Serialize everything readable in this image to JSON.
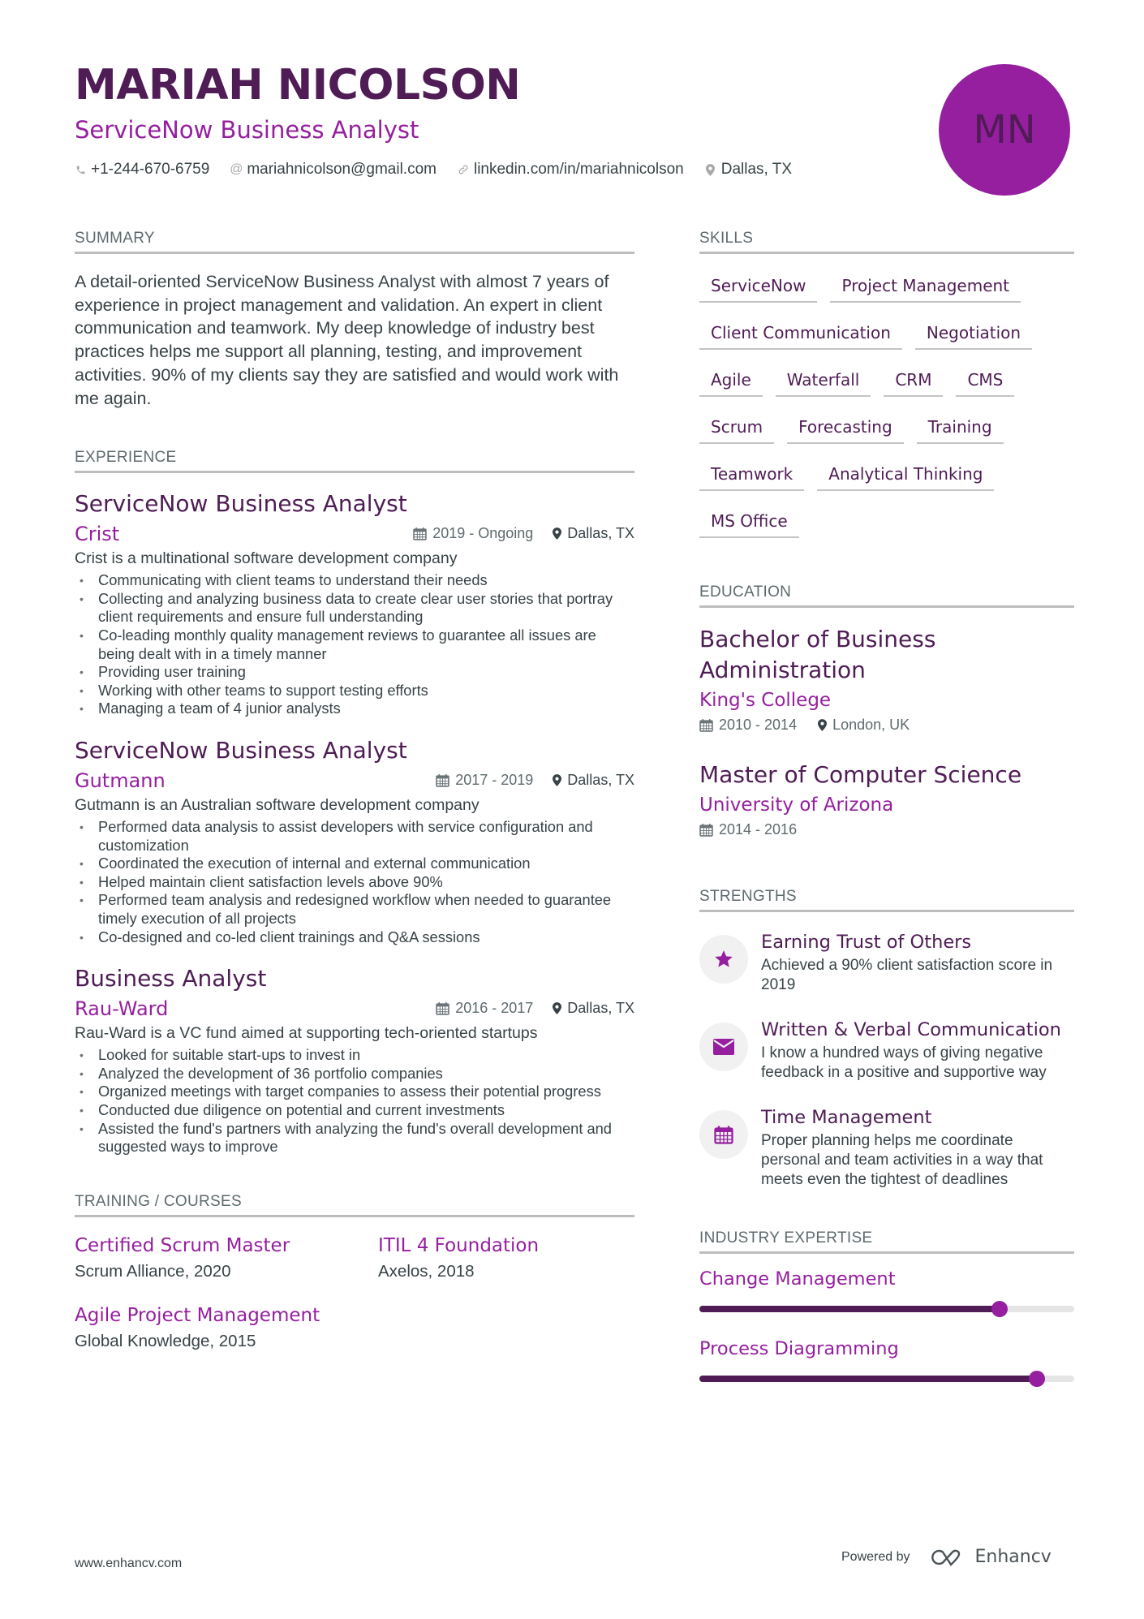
{
  "header": {
    "name": "MARIAH NICOLSON",
    "role": "ServiceNow Business Analyst",
    "initials": "MN",
    "contacts": [
      {
        "icon": "phone-icon",
        "text": "+1-244-670-6759"
      },
      {
        "icon": "at-icon",
        "text": "mariahnicolson@gmail.com"
      },
      {
        "icon": "link-icon",
        "text": "linkedin.com/in/mariahnicolson"
      },
      {
        "icon": "location-pin-icon",
        "text": "Dallas, TX"
      }
    ]
  },
  "summary": {
    "title": "SUMMARY",
    "text": "A detail-oriented ServiceNow Business Analyst with almost 7 years of experience in project management and validation. An expert in client communication and teamwork. My deep knowledge of industry best practices helps me support all planning, testing, and improvement activities. 90% of my clients say they are satisfied and would work with me again."
  },
  "experience": {
    "title": "EXPERIENCE",
    "jobs": [
      {
        "title": "ServiceNow Business Analyst",
        "company": "Crist",
        "dates": "2019 - Ongoing",
        "location": "Dallas, TX",
        "description": "Crist is a multinational software development company",
        "bullets": [
          "Communicating with client teams to understand their needs",
          "Collecting and analyzing business data to create clear user stories that portray client requirements and ensure full understanding",
          "Co-leading monthly quality management reviews to guarantee all issues are being dealt with in a timely manner",
          "Providing user training",
          "Working with other teams to support testing efforts",
          "Managing a team of 4 junior analysts"
        ]
      },
      {
        "title": "ServiceNow Business Analyst",
        "company": "Gutmann",
        "dates": "2017 - 2019",
        "location": "Dallas, TX",
        "description": "Gutmann is an Australian software development company",
        "bullets": [
          "Performed data analysis to assist developers with service configuration and customization",
          "Coordinated the execution of internal and external communication",
          "Helped maintain client satisfaction levels above 90%",
          "Performed team analysis and redesigned workflow when needed to guarantee timely execution of all projects",
          "Co-designed and co-led client trainings and Q&A sessions"
        ]
      },
      {
        "title": "Business Analyst",
        "company": "Rau-Ward",
        "dates": "2016 - 2017",
        "location": "Dallas, TX",
        "description": "Rau-Ward is a VC fund aimed at supporting tech-oriented startups",
        "bullets": [
          "Looked for suitable start-ups to invest in",
          "Analyzed the development of 36 portfolio companies",
          "Organized meetings with target companies to assess their potential progress",
          "Conducted due diligence on potential and current investments",
          "Assisted the fund's partners with analyzing the fund's overall development and suggested ways to improve"
        ]
      }
    ]
  },
  "training": {
    "title": "TRAINING / COURSES",
    "items": [
      {
        "name": "Certified Scrum Master",
        "org": "Scrum Alliance, 2020"
      },
      {
        "name": "ITIL 4 Foundation",
        "org": "Axelos, 2018"
      },
      {
        "name": "Agile Project Management",
        "org": "Global Knowledge, 2015"
      }
    ]
  },
  "skills": {
    "title": "SKILLS",
    "items": [
      "ServiceNow",
      "Project Management",
      "Client Communication",
      "Negotiation",
      "Agile",
      "Waterfall",
      "CRM",
      "CMS",
      "Scrum",
      "Forecasting",
      "Training",
      "Teamwork",
      "Analytical Thinking",
      "MS Office"
    ]
  },
  "education": {
    "title": "EDUCATION",
    "items": [
      {
        "degree": "Bachelor of Business Administration",
        "school": "King's College",
        "dates": "2010 - 2014",
        "location": "London, UK"
      },
      {
        "degree": "Master of Computer Science",
        "school": "University of Arizona",
        "dates": "2014 - 2016",
        "location": ""
      }
    ]
  },
  "strengths": {
    "title": "STRENGTHS",
    "items": [
      {
        "icon": "star-icon",
        "title": "Earning Trust of Others",
        "desc": "Achieved a 90% client satisfaction score in 2019"
      },
      {
        "icon": "envelope-icon",
        "title": "Written & Verbal Communication",
        "desc": "I know a hundred ways of giving negative feedback in a positive and supportive way"
      },
      {
        "icon": "calendar-icon",
        "title": "Time Management",
        "desc": "Proper planning helps me coordinate personal and team activities in a way that meets even the tightest of deadlines"
      }
    ]
  },
  "industry_expertise": {
    "title": "INDUSTRY EXPERTISE",
    "items": [
      {
        "name": "Change Management",
        "level": 0.8
      },
      {
        "name": "Process Diagramming",
        "level": 0.9
      }
    ]
  },
  "footer": {
    "website": "www.enhancv.com",
    "powered_by": "Powered by",
    "brand": "Enhancv"
  },
  "colors": {
    "primary_dark": "#4f1c55",
    "accent": "#951f9f",
    "text": "#384347",
    "muted": "#5e6a6e",
    "rule": "#bdbdbd"
  }
}
